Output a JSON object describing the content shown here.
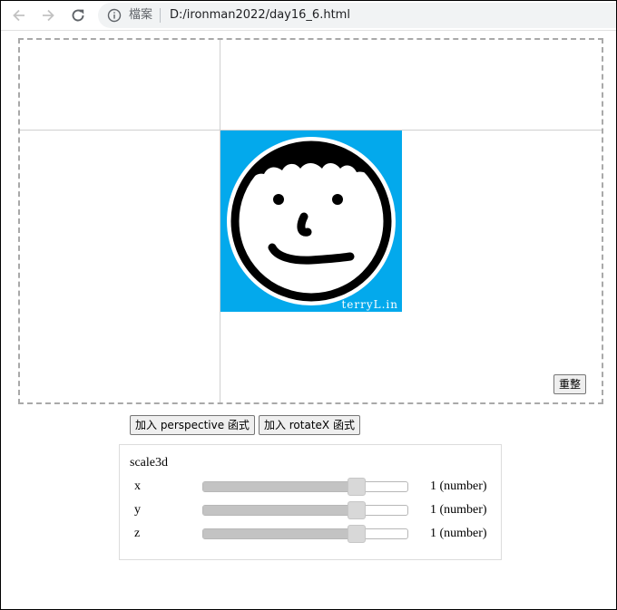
{
  "browser": {
    "back_icon": "arrow-left-icon",
    "forward_icon": "arrow-right-icon",
    "reload_icon": "reload-icon",
    "site_info_icon": "info-icon",
    "site_label": "檔案",
    "url": "D:/ironman2022/day16_6.html"
  },
  "stage": {
    "image_watermark": "terryL.in",
    "image_bg_color": "#03a9ec",
    "reset_label": "重整"
  },
  "controls": {
    "perspective_label": "加入 perspective 函式",
    "rotatex_label": "加入 rotateX 函式"
  },
  "panel": {
    "title": "scale3d",
    "rows": [
      {
        "label": "x",
        "value": "1 (number)",
        "level": 0.75
      },
      {
        "label": "y",
        "value": "1 (number)",
        "level": 0.75
      },
      {
        "label": "z",
        "value": "1 (number)",
        "level": 0.75
      }
    ]
  }
}
